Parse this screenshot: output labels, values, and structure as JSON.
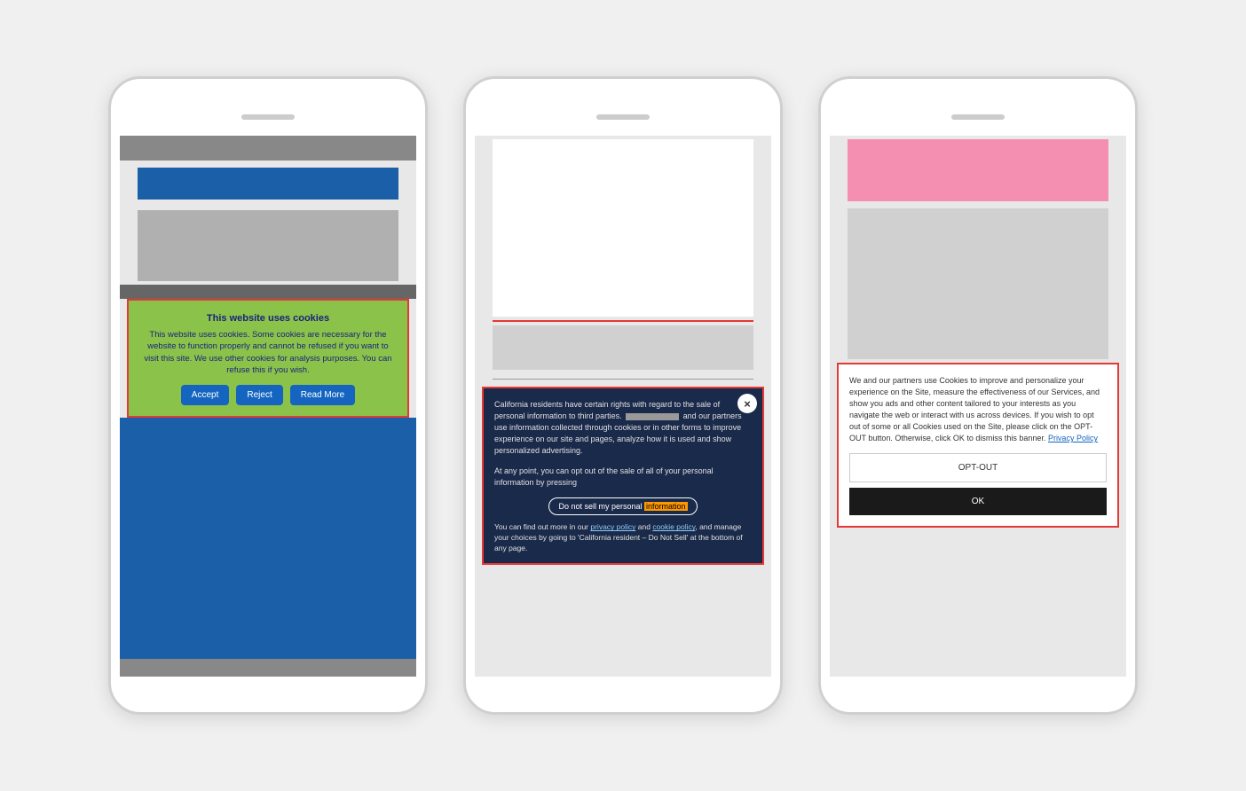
{
  "page": {
    "background": "#f0f0f0"
  },
  "phone1": {
    "cookie_banner": {
      "title": "This website uses cookies",
      "text": "This website uses cookies. Some cookies are necessary for the website to function properly and cannot be refused if you want to visit this site. We use other cookies for analysis purposes. You can refuse this if you wish.",
      "accept_label": "Accept",
      "reject_label": "Reject",
      "read_more_label": "Read More"
    }
  },
  "phone2": {
    "california_panel": {
      "close_label": "×",
      "text1": "California residents have certain rights with regard to the sale of personal information to third parties.",
      "text2": "and our partners use information collected through cookies or in other forms to improve experience on our site and pages, analyze how it is used and show personalized advertising.",
      "text3": "At any point, you can opt out of the sale of all of your personal information by pressing",
      "opt_out_btn": "Do not sell my personal information",
      "opt_out_highlight": "information",
      "footer_text1": "You can find out more in our ",
      "privacy_link": "privacy policy",
      "footer_text2": " and ",
      "cookie_link": "cookie policy",
      "footer_text3": ", and manage your choices by going to 'California resident – Do Not Sell' at the bottom of any page."
    }
  },
  "phone3": {
    "partners_banner": {
      "text": "We and our partners use Cookies to improve and personalize your experience on the Site, measure the effectiveness of our Services, and show you ads and other content tailored to your interests as you navigate the web or interact with us across devices. If you wish to opt out of some or all Cookies used on the Site, please click on the OPT-OUT button. Otherwise, click OK to dismiss this banner.",
      "privacy_link": "Privacy Policy",
      "opt_out_label": "OPT-OUT",
      "ok_label": "OK"
    }
  }
}
